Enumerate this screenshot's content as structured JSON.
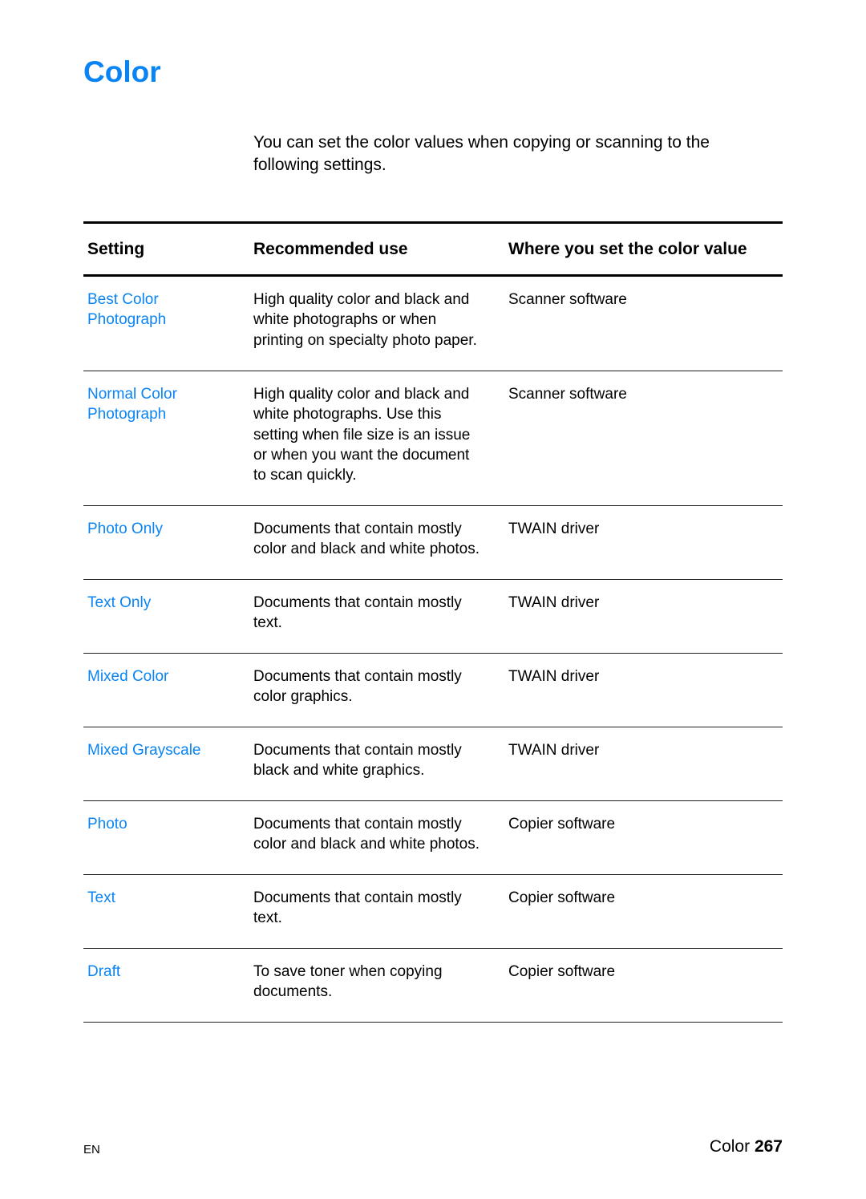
{
  "page": {
    "title": "Color",
    "intro": "You can set the color values when copying or scanning to the following settings."
  },
  "table": {
    "headers": [
      "Setting",
      "Recommended use",
      "Where you set the color value"
    ],
    "rows": [
      {
        "setting": "Best Color\nPhotograph",
        "use": "High quality color and black and\nwhite photographs or when\nprinting on specialty photo paper.",
        "where": "Scanner software"
      },
      {
        "setting": "Normal Color\nPhotograph",
        "use": "High quality color and black and\nwhite photographs. Use this\nsetting when file size is an issue\nor when you want the document\nto scan quickly.",
        "where": "Scanner software"
      },
      {
        "setting": "Photo Only",
        "use": "Documents that contain mostly\ncolor and black and white photos.",
        "where": "TWAIN driver"
      },
      {
        "setting": "Text Only",
        "use": "Documents that contain mostly\ntext.",
        "where": "TWAIN driver"
      },
      {
        "setting": "Mixed Color",
        "use": "Documents that contain mostly\ncolor graphics.",
        "where": "TWAIN driver"
      },
      {
        "setting": "Mixed Grayscale",
        "use": "Documents that contain mostly\nblack and white graphics.",
        "where": "TWAIN driver"
      },
      {
        "setting": "Photo",
        "use": "Documents that contain mostly\ncolor and black and white photos.",
        "where": "Copier software"
      },
      {
        "setting": "Text",
        "use": "Documents that contain mostly\ntext.",
        "where": "Copier software"
      },
      {
        "setting": "Draft",
        "use": "To save toner when copying\ndocuments.",
        "where": "Copier software"
      }
    ]
  },
  "footer": {
    "left": "EN",
    "section": "Color",
    "page_number": "267"
  },
  "colors": {
    "accent": "#0a84f4"
  }
}
